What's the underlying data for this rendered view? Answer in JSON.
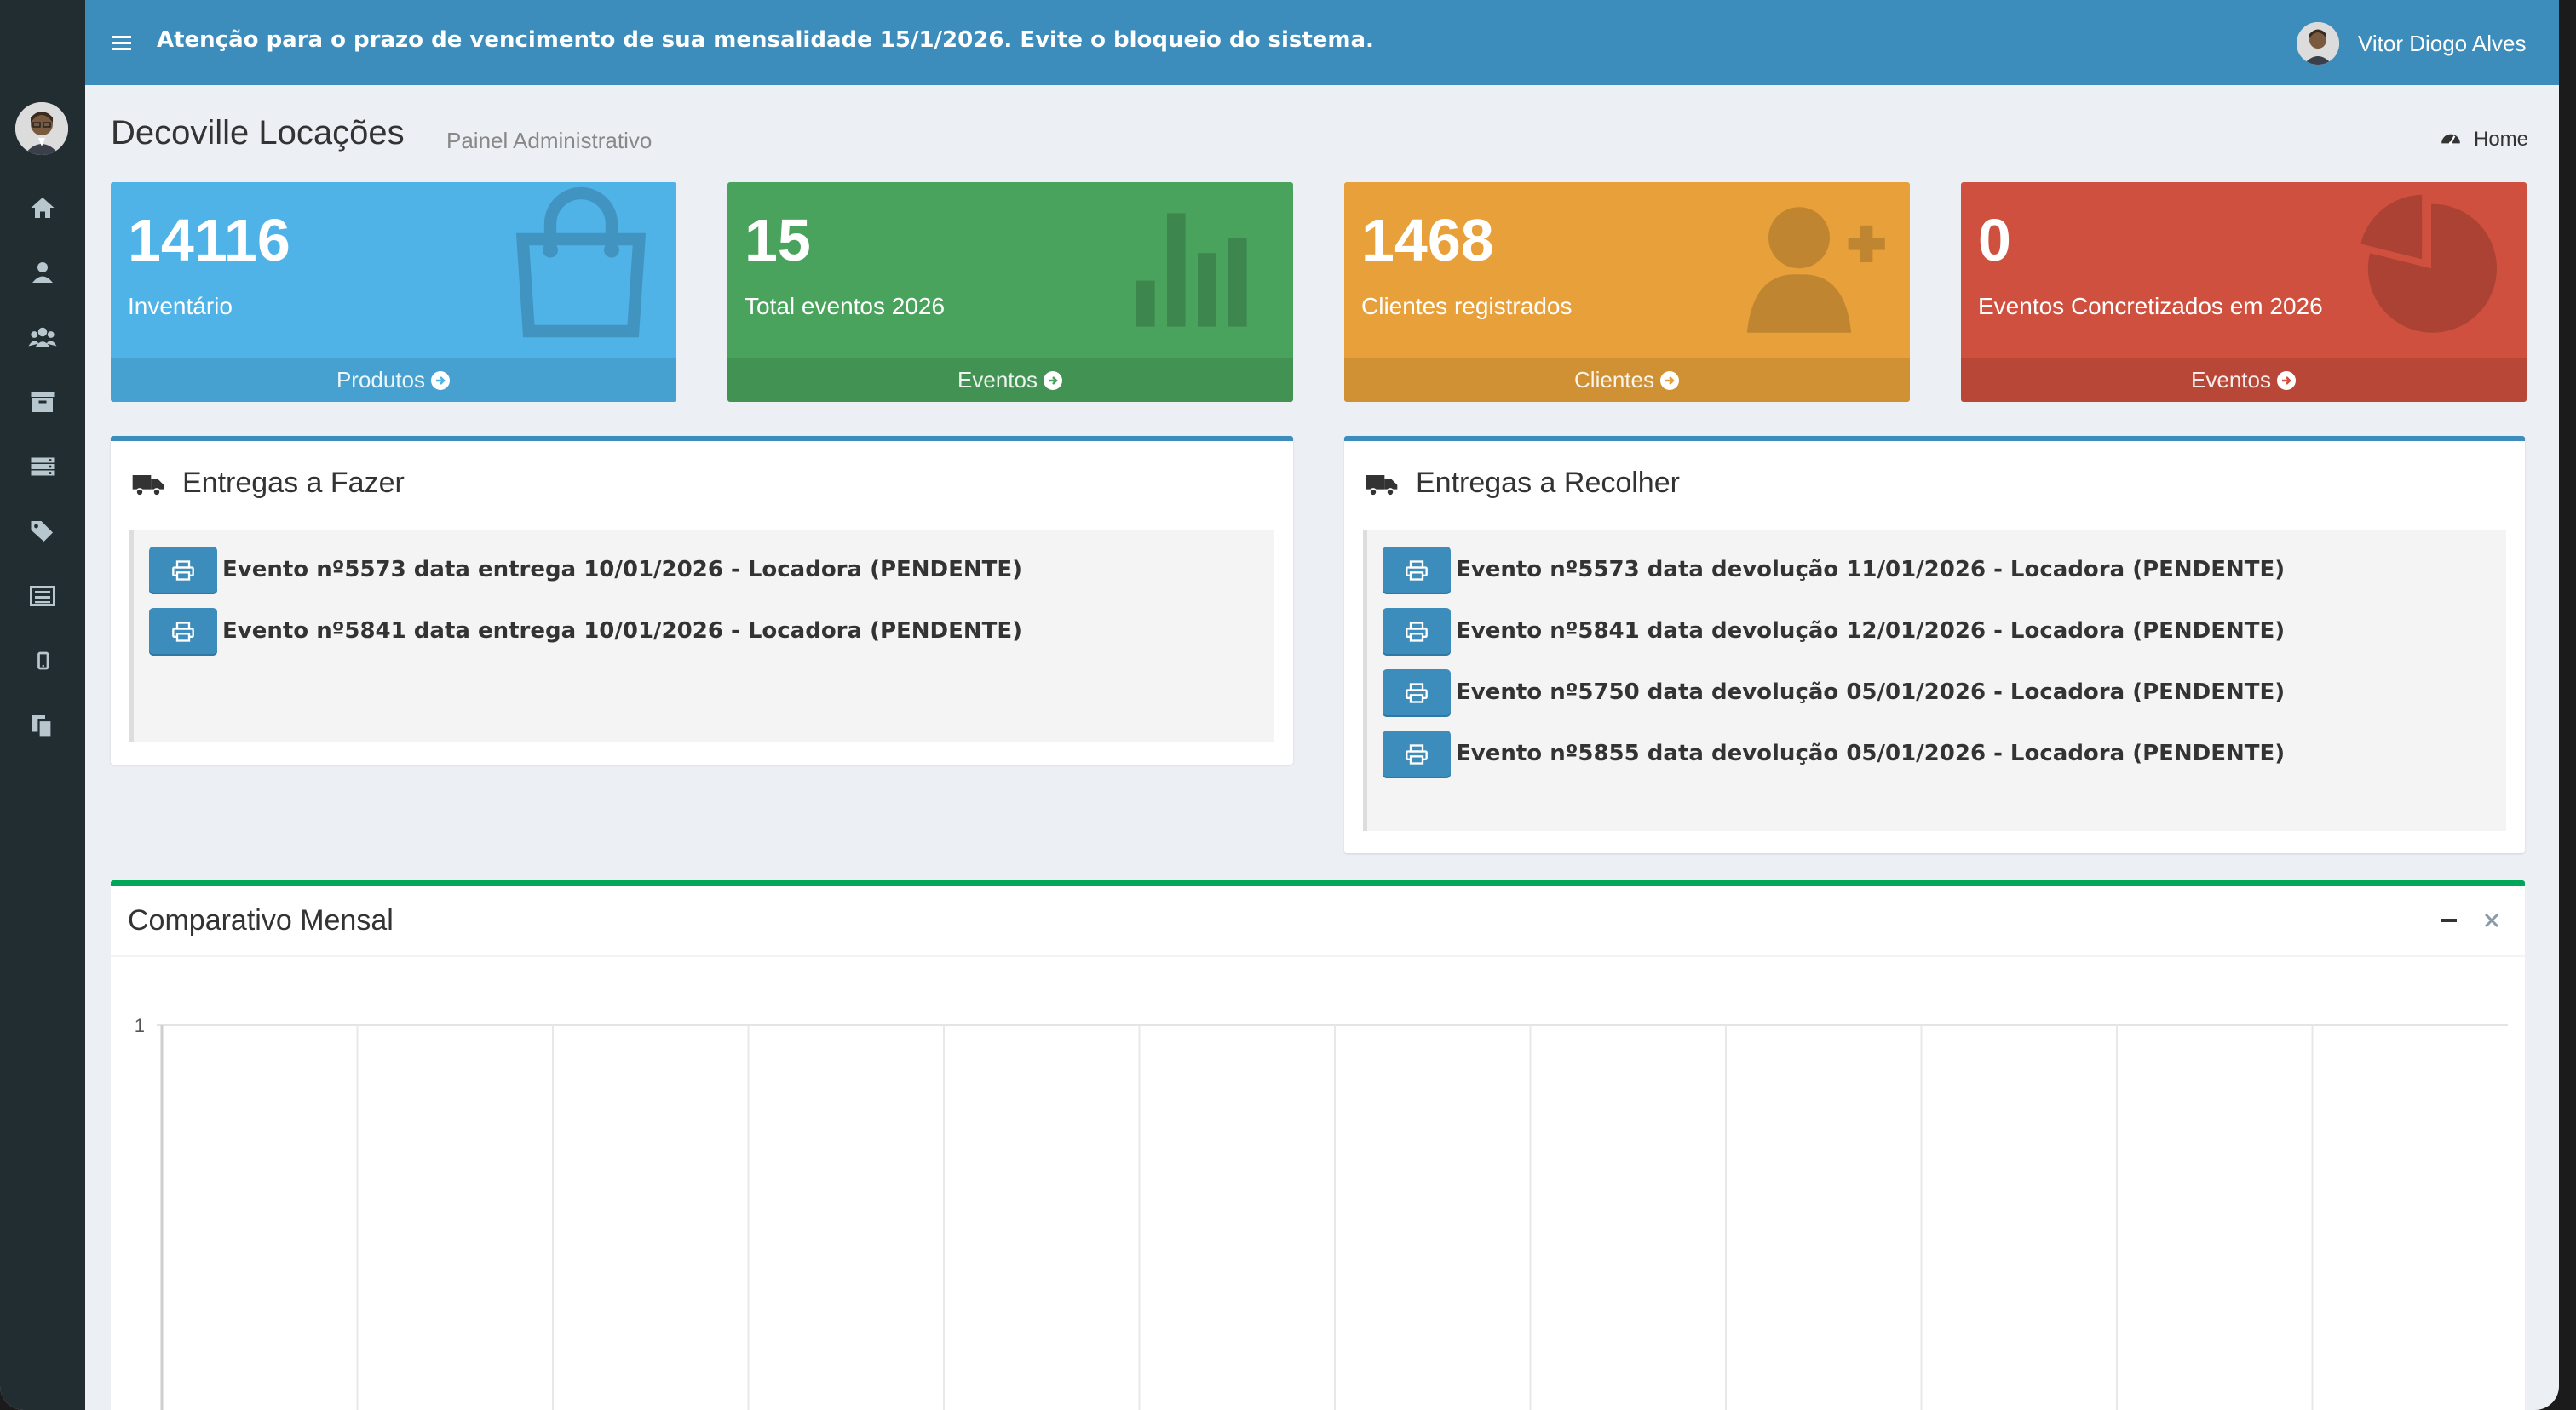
{
  "topbar": {
    "alert": "Atenção para o prazo de vencimento de sua mensalidade 15/1/2026. Evite o bloqueio do sistema.",
    "user_name": "Vitor Diogo Alves"
  },
  "header": {
    "title": "Decoville Locações",
    "subtitle": "Painel Administrativo",
    "breadcrumb": "Home"
  },
  "sidebar": {
    "icons": [
      "home-icon",
      "user-icon",
      "users-icon",
      "archive-icon",
      "server-icon",
      "tags-icon",
      "list-icon",
      "mobile-icon",
      "copy-icon"
    ]
  },
  "tiles": [
    {
      "value": "14116",
      "caption": "Inventário",
      "link": "Produtos",
      "color": "#4fb3e8",
      "icon": "shopping-bag-icon"
    },
    {
      "value": "15",
      "caption": "Total eventos 2026",
      "link": "Eventos",
      "color": "#4aa35d",
      "icon": "bar-chart-icon"
    },
    {
      "value": "1468",
      "caption": "Clientes registrados",
      "link": "Clientes",
      "color": "#e8a13a",
      "icon": "user-plus-icon"
    },
    {
      "value": "0",
      "caption": "Eventos Concretizados em 2026",
      "link": "Eventos",
      "color": "#cf503f",
      "icon": "pie-chart-icon"
    }
  ],
  "deliveries": {
    "title": "Entregas a Fazer",
    "items": [
      "Evento nº5573 data entrega 10/01/2026 - Locadora (PENDENTE)",
      "Evento nº5841 data entrega 10/01/2026 - Locadora (PENDENTE)"
    ]
  },
  "pickups": {
    "title": "Entregas a Recolher",
    "items": [
      "Evento nº5573 data devolução 11/01/2026 - Locadora (PENDENTE)",
      "Evento nº5841 data devolução 12/01/2026 - Locadora (PENDENTE)",
      "Evento nº5750 data devolução 05/01/2026 - Locadora (PENDENTE)",
      "Evento nº5855 data devolução 05/01/2026 - Locadora (PENDENTE)"
    ]
  },
  "chart": {
    "title": "Comparativo Mensal"
  },
  "chart_data": {
    "type": "line",
    "title": "Comparativo Mensal",
    "y_tick_labels": [
      "1"
    ],
    "grid": true,
    "series": []
  }
}
